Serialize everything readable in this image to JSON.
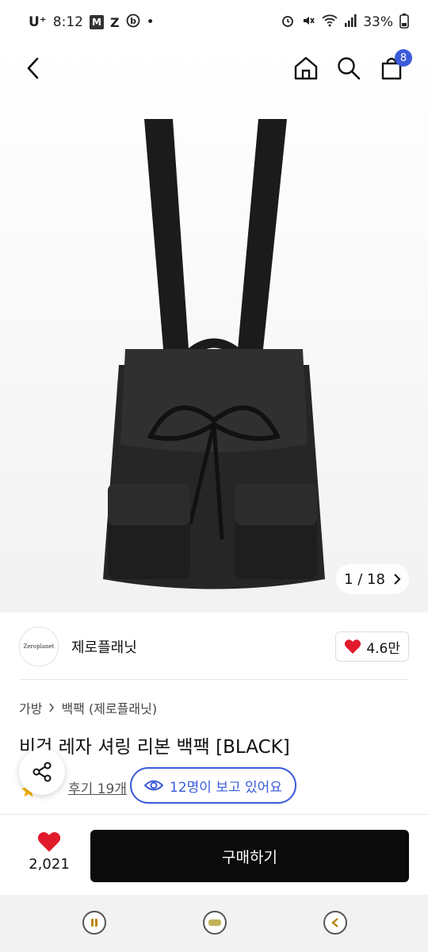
{
  "status_bar": {
    "carrier": "U⁺",
    "time": "8:12",
    "battery": "33%",
    "icons": [
      "m-notification-icon",
      "z-notification-icon",
      "b-notification-icon",
      "alarm-icon",
      "mute-icon",
      "wifi-icon",
      "signal-icon",
      "battery-icon"
    ]
  },
  "nav": {
    "back_icon": "back-arrow-icon",
    "home_icon": "home-icon",
    "search_icon": "search-icon",
    "cart_icon": "shopping-bag-icon",
    "cart_count": "8"
  },
  "gallery": {
    "counter": "1 / 18",
    "next_icon": "chevron-right-icon"
  },
  "store": {
    "logo_text": "Zeroplanet",
    "name": "제로플래닛",
    "likes": "4.6만"
  },
  "breadcrumb": {
    "level1": "가방",
    "level2": "백팩 (제로플래닛)"
  },
  "product": {
    "title": "비건 레자 셔링 리본 백팩 [BLACK]",
    "review_link": "후기 19개",
    "viewers": "12명이 보고 있어요"
  },
  "purchase_bar": {
    "wish_count": "2,021",
    "buy_label": "구매하기"
  },
  "colors": {
    "accent": "#3b5bdb",
    "heart": "#e21b2c",
    "buy_button": "#0b0b0b"
  }
}
